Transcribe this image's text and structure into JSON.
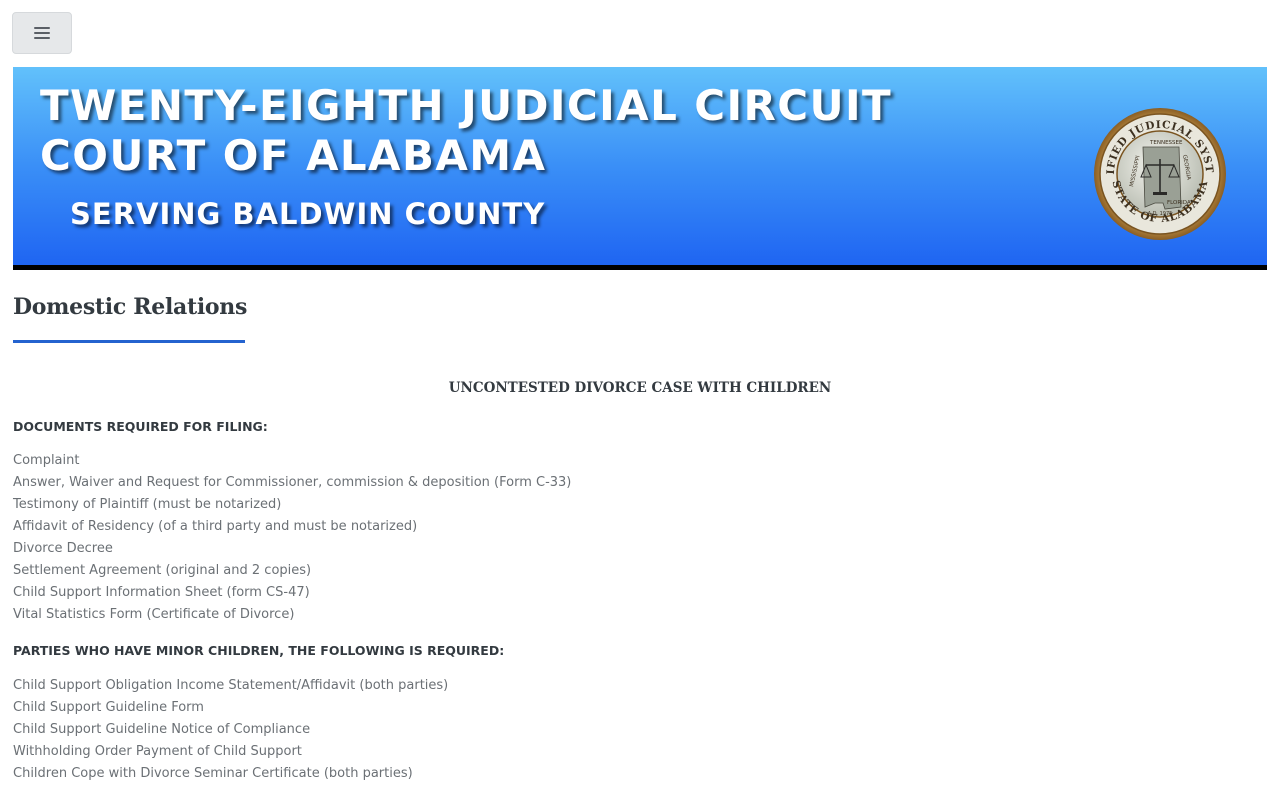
{
  "nav": {
    "menu_button": "hamburger-menu"
  },
  "banner": {
    "title": "TWENTY-EIGHTH JUDICIAL CIRCUIT COURT OF ALABAMA",
    "subtitle": "SERVING BALDWIN COUNTY",
    "seal": {
      "ring_top": "UNIFIED JUDICIAL SYSTEM",
      "ring_bottom": "STATE OF ALABAMA",
      "states": [
        "MISSISSIPPI",
        "TENNESSEE",
        "GEORGIA",
        "FLORIDA"
      ],
      "date": "A.D. 1975"
    }
  },
  "page": {
    "title": "Domestic Relations",
    "case_heading": "UNCONTESTED DIVORCE CASE WITH CHILDREN",
    "sections": [
      {
        "heading": "DOCUMENTS REQUIRED FOR FILING:",
        "items": [
          "Complaint",
          "Answer, Waiver and Request for Commissioner, commission & deposition (Form C-33)",
          "Testimony of Plaintiff (must be notarized)",
          "Affidavit of Residency (of a third party and must be notarized)",
          "Divorce Decree",
          "Settlement Agreement (original and 2 copies)",
          "Child Support Information Sheet (form CS-47)",
          "Vital Statistics Form (Certificate of Divorce)"
        ]
      },
      {
        "heading": "PARTIES WHO HAVE MINOR CHILDREN, THE FOLLOWING IS REQUIRED:",
        "items": [
          "Child Support Obligation Income Statement/Affidavit (both parties)",
          "Child Support Guideline Form",
          "Child Support Guideline Notice of Compliance",
          "Withholding Order Payment of Child Support",
          "Children Cope with Divorce Seminar Certificate (both parties)"
        ]
      }
    ]
  }
}
